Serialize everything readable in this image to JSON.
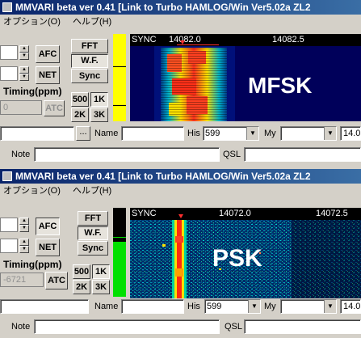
{
  "windows": [
    {
      "title": "MMVARI beta ver 0.41 [Link to Turbo HAMLOG/Win Ver5.02a ZL2",
      "menu": [
        "オプション(O)",
        "ヘルプ(H)"
      ],
      "controls": {
        "afc": "AFC",
        "net": "NET",
        "fft": "FFT",
        "wf": "W.F.",
        "sync": "Sync",
        "timing_label": "Timing(ppm)",
        "timing_value": "0",
        "atc": "ATC",
        "span_500": "500",
        "span_1k": "1K",
        "span_2k": "2K",
        "span_3k": "3K"
      },
      "scale": {
        "sync": "SYNC",
        "marks": [
          "14082.0",
          "14082.5"
        ]
      },
      "mode_label": "MFSK",
      "log": {
        "ellipsis": "...",
        "name_label": "Name",
        "his_label": "His",
        "his_value": "599",
        "my_label": "My",
        "my_value": "",
        "freq": "14.0",
        "note_label": "Note",
        "qsl_label": "QSL"
      },
      "colors": {
        "level_bar": "#ffff00"
      }
    },
    {
      "title": "MMVARI beta ver 0.41 [Link to Turbo HAMLOG/Win Ver5.02a ZL2",
      "menu": [
        "オプション(O)",
        "ヘルプ(H)"
      ],
      "controls": {
        "afc": "AFC",
        "net": "NET",
        "fft": "FFT",
        "wf": "W.F.",
        "sync": "Sync",
        "timing_label": "Timing(ppm)",
        "timing_value": "-6721",
        "atc": "ATC",
        "span_500": "500",
        "span_1k": "1K",
        "span_2k": "2K",
        "span_3k": "3K"
      },
      "scale": {
        "sync": "SYNC",
        "marks": [
          "14072.0",
          "14072.5"
        ]
      },
      "mode_label": "PSK",
      "log": {
        "ellipsis": "...",
        "name_label": "Name",
        "his_label": "His",
        "his_value": "599",
        "my_label": "My",
        "my_value": "",
        "freq": "14.0",
        "note_label": "Note",
        "qsl_label": "QSL"
      },
      "colors": {
        "level_bar": "#00e000"
      }
    }
  ]
}
